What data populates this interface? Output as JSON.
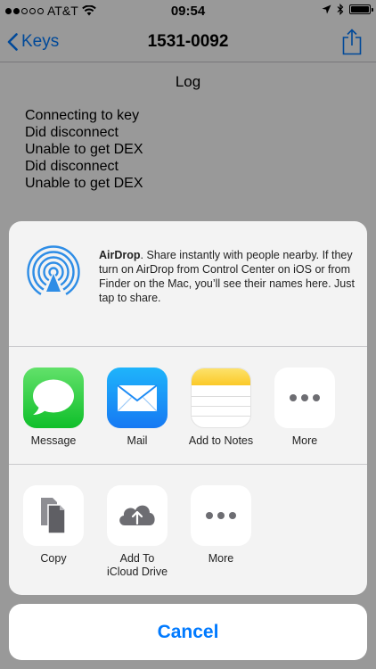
{
  "status_bar": {
    "carrier": "AT&T",
    "time": "09:54"
  },
  "nav": {
    "back_label": "Keys",
    "title": "1531-0092"
  },
  "log": {
    "title": "Log",
    "lines": [
      "Connecting to key",
      "Did disconnect",
      "Unable to get DEX",
      "Did disconnect",
      "Unable to get DEX"
    ]
  },
  "share_sheet": {
    "airdrop": {
      "name": "AirDrop",
      "description": ". Share instantly with people nearby. If they turn on AirDrop from Control Center on iOS or from Finder on the Mac, you’ll see their names here. Just tap to share."
    },
    "apps": [
      {
        "label": "Message",
        "icon": "messages-icon"
      },
      {
        "label": "Mail",
        "icon": "mail-icon"
      },
      {
        "label": "Add to Notes",
        "icon": "notes-icon"
      },
      {
        "label": "More",
        "icon": "more-icon"
      }
    ],
    "actions": [
      {
        "label": "Copy",
        "icon": "copy-icon"
      },
      {
        "label": "Add To\niCloud Drive",
        "icon": "icloud-upload-icon"
      },
      {
        "label": "More",
        "icon": "more-icon"
      }
    ],
    "cancel_label": "Cancel"
  },
  "colors": {
    "tint": "#007aff",
    "sheet_bg": "#f3f3f3",
    "airdrop_blue": "#2e8de6"
  }
}
